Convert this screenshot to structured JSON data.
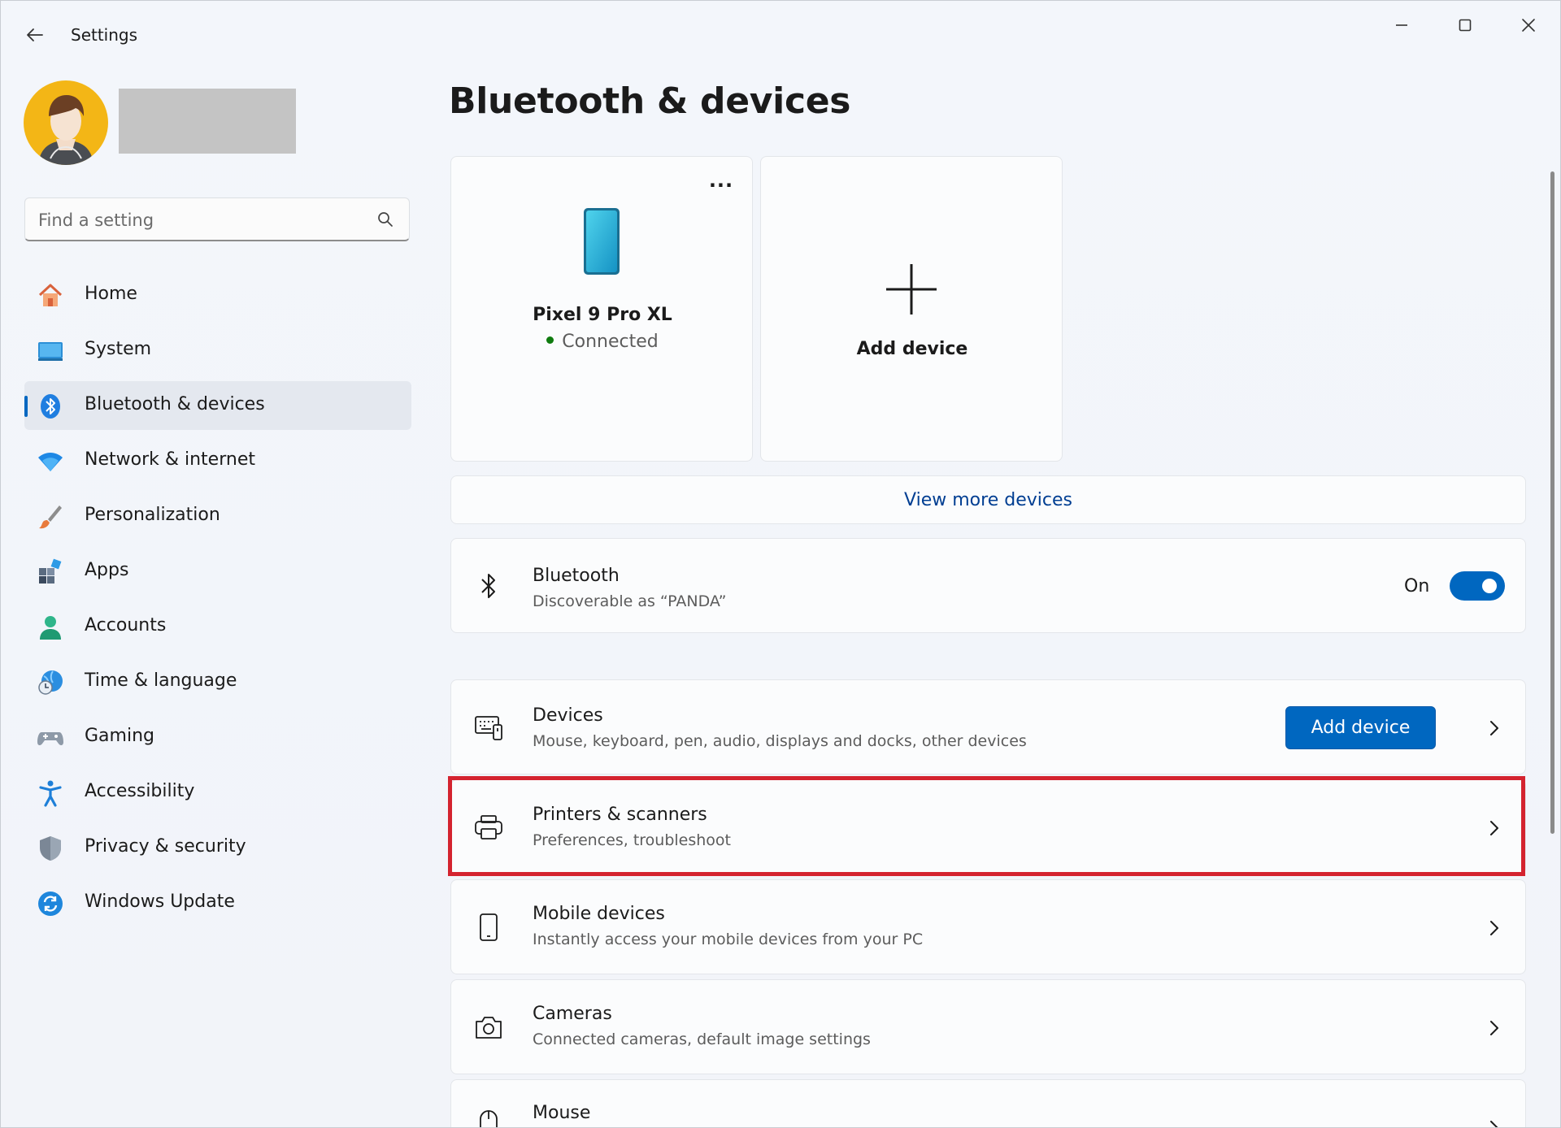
{
  "window": {
    "title": "Settings",
    "controls": {
      "minimize": "minimize-icon",
      "maximize": "maximize-icon",
      "close": "close-icon"
    }
  },
  "sidebar": {
    "search": {
      "placeholder": "Find a setting",
      "value": ""
    },
    "items": [
      {
        "label": "Home",
        "icon": "home-icon",
        "active": false
      },
      {
        "label": "System",
        "icon": "system-icon",
        "active": false
      },
      {
        "label": "Bluetooth & devices",
        "icon": "bluetooth-icon",
        "active": true
      },
      {
        "label": "Network & internet",
        "icon": "wifi-icon",
        "active": false
      },
      {
        "label": "Personalization",
        "icon": "brush-icon",
        "active": false
      },
      {
        "label": "Apps",
        "icon": "apps-icon",
        "active": false
      },
      {
        "label": "Accounts",
        "icon": "account-icon",
        "active": false
      },
      {
        "label": "Time & language",
        "icon": "globe-clock-icon",
        "active": false
      },
      {
        "label": "Gaming",
        "icon": "controller-icon",
        "active": false
      },
      {
        "label": "Accessibility",
        "icon": "accessibility-icon",
        "active": false
      },
      {
        "label": "Privacy & security",
        "icon": "shield-icon",
        "active": false
      },
      {
        "label": "Windows Update",
        "icon": "update-icon",
        "active": false
      }
    ]
  },
  "main": {
    "title": "Bluetooth & devices",
    "device_card": {
      "name": "Pixel 9 Pro XL",
      "status": "Connected",
      "more": "..."
    },
    "add_card": {
      "label": "Add device"
    },
    "view_more": "View more devices",
    "bluetooth": {
      "title": "Bluetooth",
      "subtitle": "Discoverable as “PANDA”",
      "toggle_label": "On",
      "toggle_on": true
    },
    "rows": [
      {
        "title": "Devices",
        "subtitle": "Mouse, keyboard, pen, audio, displays and docks, other devices",
        "button": "Add device",
        "icon": "keyboard-devices-icon"
      },
      {
        "title": "Printers & scanners",
        "subtitle": "Preferences, troubleshoot",
        "icon": "printer-icon",
        "highlighted": true
      },
      {
        "title": "Mobile devices",
        "subtitle": "Instantly access your mobile devices from your PC",
        "icon": "mobile-icon"
      },
      {
        "title": "Cameras",
        "subtitle": "Connected cameras, default image settings",
        "icon": "camera-icon"
      },
      {
        "title": "Mouse",
        "subtitle": "",
        "icon": "mouse-icon"
      }
    ]
  },
  "colors": {
    "accent": "#0067c0",
    "highlight": "#d4232f",
    "status_connected": "#0f7b0f"
  }
}
